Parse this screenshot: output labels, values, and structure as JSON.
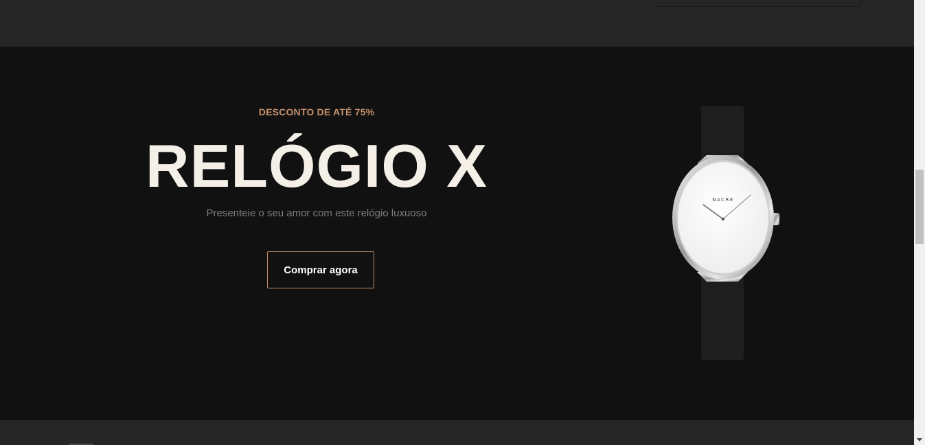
{
  "hero": {
    "eyebrow": "DESCONTO DE ATÉ 75%",
    "title": "RELÓGIO X",
    "subtitle": "Presenteie o seu amor com este relógio luxuoso",
    "cta_label": "Comprar agora"
  },
  "watch": {
    "brand": "NACRE",
    "icon": "wristwatch-image"
  },
  "colors": {
    "accent": "#c4906a",
    "hero_bg": "#111111",
    "band_bg": "#262626",
    "title": "#f5f0e7"
  },
  "scrollbar": {
    "down_icon": "scroll-down-arrow-icon"
  }
}
